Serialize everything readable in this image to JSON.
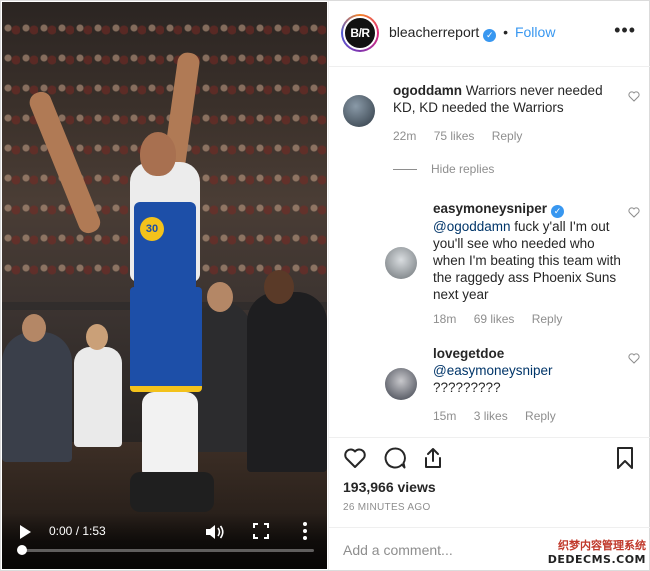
{
  "header": {
    "avatar_text": "B/R",
    "username": "bleacherreport",
    "separator": "•",
    "follow_label": "Follow",
    "more_label": "•••"
  },
  "video": {
    "jersey_number": "30",
    "time_display": "0:00 / 1:53",
    "progress": 0.0
  },
  "comments": [
    {
      "username": "ogoddamn",
      "text": "Warriors never needed KD, KD needed the Warriors",
      "time": "22m",
      "likes": "75 likes",
      "reply_label": "Reply",
      "hide_replies_label": "Hide replies"
    },
    {
      "username": "easymoneysniper",
      "verified": true,
      "mention": "@ogoddamn",
      "text": "fuck y'all I'm out you'll see who needed who when I'm beating this team with the raggedy ass Phoenix Suns next year",
      "time": "18m",
      "likes": "69 likes",
      "reply_label": "Reply"
    },
    {
      "username": "lovegetdoe",
      "mention": "@easymoneysniper",
      "text": "?????????",
      "time": "15m",
      "likes": "3 likes",
      "reply_label": "Reply"
    }
  ],
  "stats": {
    "views": "193,966 views",
    "posted": "26 MINUTES AGO"
  },
  "add_comment": {
    "placeholder": "Add a comment..."
  },
  "watermark": {
    "line1": "织梦内容管理系统",
    "line2": "DEDECMS.COM"
  },
  "colors": {
    "accent": "#3897f0",
    "text": "#262626",
    "muted": "#8e8e8e",
    "jersey_blue": "#1d4fa8",
    "jersey_gold": "#f3c21b"
  }
}
